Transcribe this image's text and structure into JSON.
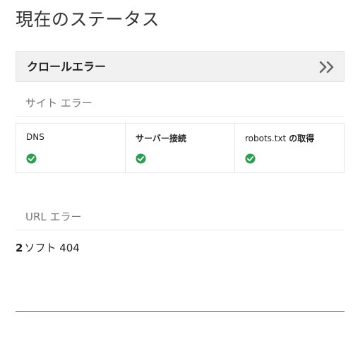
{
  "page": {
    "title": "現在のステータス"
  },
  "crawl_errors": {
    "label": "クロールエラー",
    "expand_icon": "double-chevron-right-icon"
  },
  "site_errors": {
    "section_label": "サイト エラー",
    "items": [
      {
        "label_prefix": "",
        "label_bold": "",
        "label": "DNS",
        "status": "ok",
        "icon": "check-circle-icon"
      },
      {
        "label_prefix": "",
        "label_bold": "サーバー接続",
        "label": "",
        "status": "ok",
        "icon": "check-circle-icon"
      },
      {
        "label_prefix": "robots.txt ",
        "label_bold": "の取得",
        "label": "",
        "status": "ok",
        "icon": "check-circle-icon"
      }
    ]
  },
  "url_errors": {
    "section_label": "URL エラー",
    "count": "2",
    "text": "ソフト 404"
  },
  "colors": {
    "ok_green": "#2e9e52",
    "header_bg": "#f1f1f1"
  }
}
